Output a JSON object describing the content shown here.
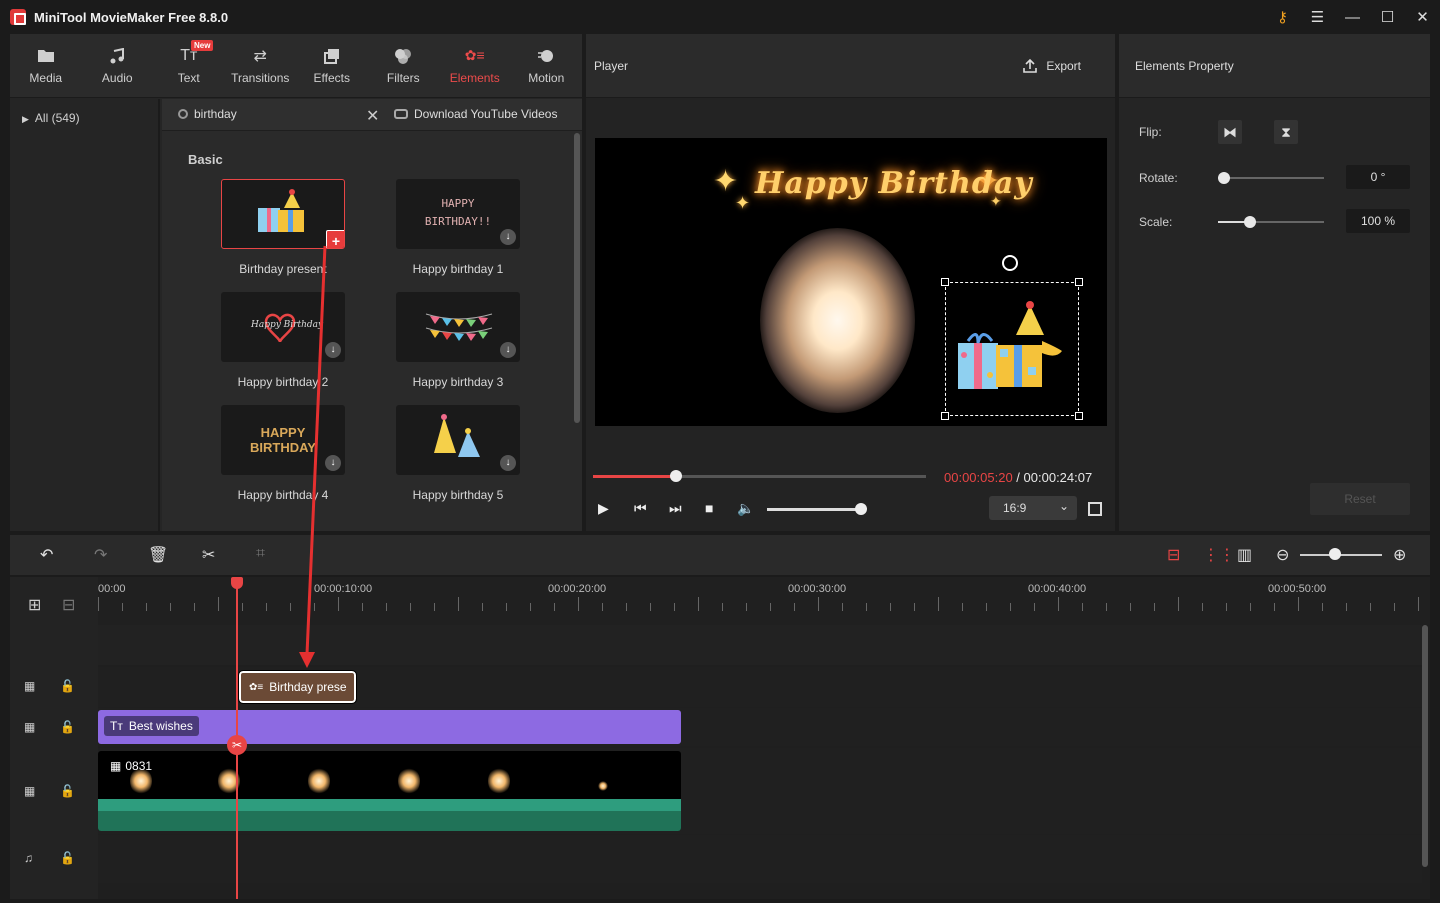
{
  "app": {
    "title": "MiniTool MovieMaker Free 8.8.0"
  },
  "toolbar": {
    "tabs": [
      {
        "label": "Media",
        "icon": "folder-icon"
      },
      {
        "label": "Audio",
        "icon": "music-note-icon"
      },
      {
        "label": "Text",
        "icon": "text-icon",
        "badge": "New"
      },
      {
        "label": "Transitions",
        "icon": "swap-icon"
      },
      {
        "label": "Effects",
        "icon": "layers-icon"
      },
      {
        "label": "Filters",
        "icon": "filters-icon"
      },
      {
        "label": "Elements",
        "icon": "elements-icon",
        "active": true
      },
      {
        "label": "Motion",
        "icon": "motion-icon"
      }
    ]
  },
  "library": {
    "sidebar_item": "All (549)",
    "search_value": "birthday",
    "youtube_link": "Download YouTube Videos",
    "section": "Basic",
    "items": [
      {
        "label": "Birthday present",
        "selected": true
      },
      {
        "label": "Happy birthday 1"
      },
      {
        "label": "Happy birthday 2"
      },
      {
        "label": "Happy birthday 3"
      },
      {
        "label": "Happy birthday 4"
      },
      {
        "label": "Happy birthday 5"
      }
    ],
    "thumb_text": {
      "hb1": "HAPPY BIRTHDAY!!",
      "hb2": "Happy Birthday",
      "hb4_line1": "HAPPY",
      "hb4_line2": "BIRTHDAY"
    }
  },
  "player": {
    "title": "Player",
    "export_label": "Export",
    "video_title": "Happy Birthday",
    "current_time": "00:00:05:20",
    "separator": " / ",
    "total_time": "00:00:24:07",
    "aspect_ratio": "16:9",
    "progress": 0.25,
    "volume": 0.9
  },
  "properties": {
    "title": "Elements Property",
    "flip_label": "Flip:",
    "rotate_label": "Rotate:",
    "rotate_value": "0 °",
    "scale_label": "Scale:",
    "scale_value": "100 %",
    "reset_label": "Reset",
    "rotate_level": 0.0,
    "scale_level": 0.3
  },
  "timeline": {
    "ruler_labels": [
      "00:00",
      "00:00:10:00",
      "00:00:20:00",
      "00:00:30:00",
      "00:00:40:00",
      "00:00:50:00"
    ],
    "element_clip": "Birthday prese",
    "text_clip": "Best wishes",
    "video_clip": "0831"
  },
  "colors": {
    "accent": "#e84545",
    "text_clip": "#8d6ae2",
    "element_clip": "#6b4a36",
    "audio_strip": "#2e9d7e"
  }
}
